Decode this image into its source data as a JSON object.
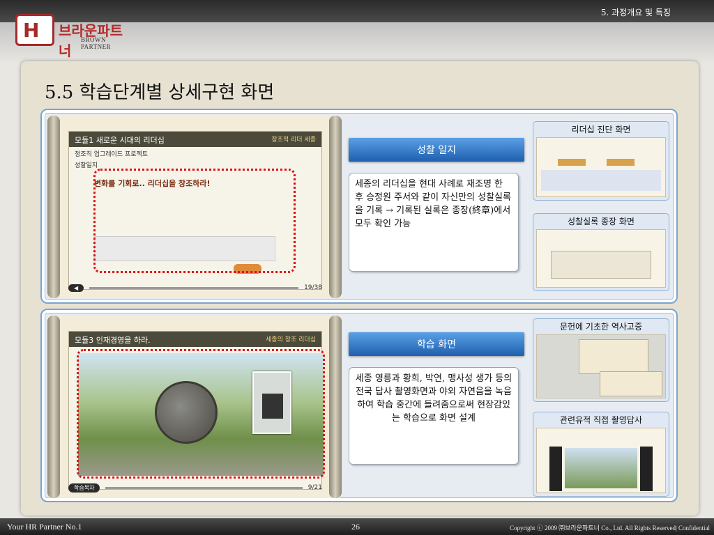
{
  "header": {
    "section": "5. 과정개요 및 특징",
    "logo_kr": "브라운파트너",
    "logo_en": "BROWN PARTNER",
    "logo_mark": "H"
  },
  "page_title": "5.5 학습단계별 상세구현 화면",
  "top": {
    "screen": {
      "module_label": "모듈1",
      "title": "새로운 시대의 리더십",
      "subtitle": "창조적 리더 세종",
      "breadcrumb": "정조직 업그레이드 프로젝트",
      "tab": "성찰일지",
      "headline": "변화를 기회로.. 리더십을 창조하라!",
      "page": "19/38"
    },
    "banner": "성찰 일지",
    "description": "세종의 리더십을 현대 사례로 재조명 한 후 승정원 주서와 같이 자신만의 성찰실록을 기록 → 기록된 실록은 종장(終章)에서 모두 확인 가능",
    "thumbs": [
      {
        "caption": "리더십 진단 화면"
      },
      {
        "caption": "성찰실록 종장 화면"
      }
    ]
  },
  "bottom": {
    "screen": {
      "module_label": "모듈3",
      "title": "인재경영을 하라.",
      "subtitle": "세종의 창조 리더십",
      "nav_left": "학습목차",
      "page": "9/21"
    },
    "banner": "학습 화면",
    "description": "세종 영릉과 황희, 박연, 맹사성 생가 등의 전국 답사 촬영화면과 야외 자연음을 녹음하여 학습 중간에 들려줌으로써 현장감있는 학습으로 화면 설계",
    "thumbs": [
      {
        "caption": "문헌에 기초한 역사고증"
      },
      {
        "caption": "관련유적 직접 촬영답사"
      }
    ]
  },
  "footer": {
    "left": "Your HR Partner No.1",
    "page": "26",
    "right": "Copyright ⓒ 2009 ㈜브라운파트너 Co., Ltd. All Rights Reserved| Confidential"
  }
}
